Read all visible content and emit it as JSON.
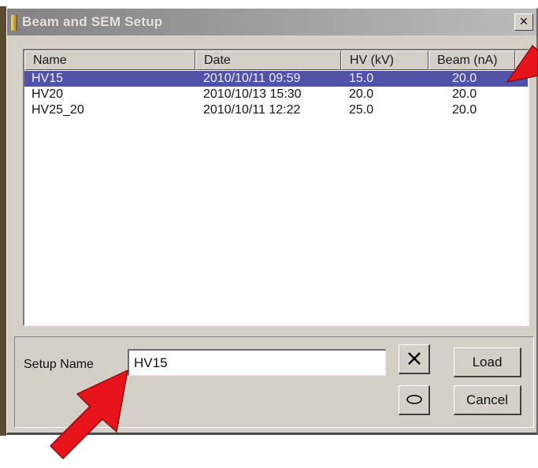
{
  "window": {
    "title": "Beam and SEM Setup",
    "close_label": "×"
  },
  "list": {
    "columns": [
      "Name",
      "Date",
      "HV (kV)",
      "Beam (nA)"
    ],
    "rows": [
      {
        "name": "HV15",
        "date": "2010/10/11 09:59",
        "hv": "15.0",
        "beam": "20.0",
        "selected": true
      },
      {
        "name": "HV20",
        "date": "2010/10/13 15:30",
        "hv": "20.0",
        "beam": "20.0",
        "selected": false
      },
      {
        "name": "HV25_20",
        "date": "2010/10/11 12:22",
        "hv": "25.0",
        "beam": "20.0",
        "selected": false
      }
    ]
  },
  "setup": {
    "label": "Setup Name",
    "value": "HV15"
  },
  "buttons": {
    "delete_icon": "x-delete-icon",
    "save_icon": "ellipse-save-icon",
    "load": "Load",
    "cancel": "Cancel"
  },
  "colors": {
    "selection": "#5151a8",
    "annotation_arrow": "#e8141c"
  }
}
